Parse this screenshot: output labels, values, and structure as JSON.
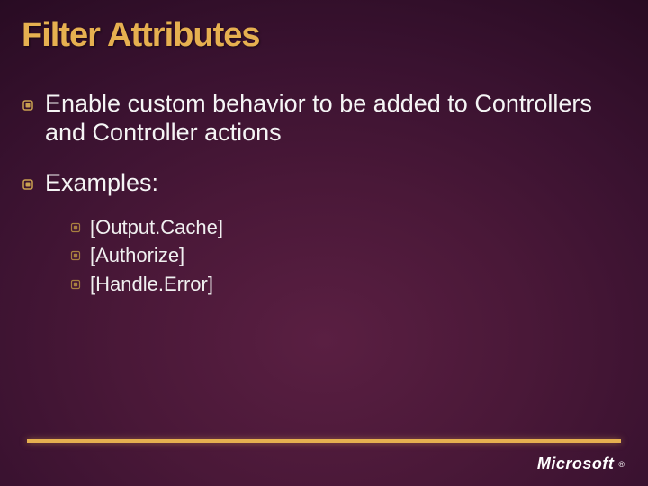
{
  "title": "Filter Attributes",
  "bullets": [
    {
      "text": "Enable custom behavior to be added to Controllers and Controller actions",
      "children": []
    },
    {
      "text": "Examples:",
      "children": [
        "[Output.Cache]",
        "[Authorize]",
        "[Handle.Error]"
      ]
    }
  ],
  "logo": "Microsoft",
  "colors": {
    "accent": "#e6b050"
  }
}
